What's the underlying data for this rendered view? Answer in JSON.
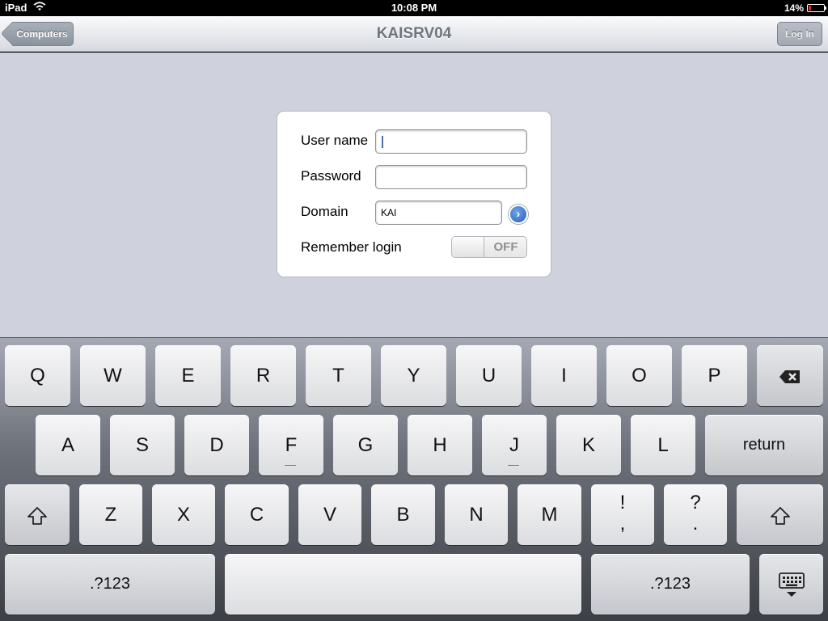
{
  "status_bar": {
    "carrier": "iPad",
    "wifi_icon": "wifi-icon",
    "time": "10:08 PM",
    "battery_percent": "14%",
    "battery_level": 0.14
  },
  "nav": {
    "back_label": "Computers",
    "title": "KAISRV04",
    "login_label": "Log In"
  },
  "form": {
    "username_label": "User name",
    "username_value": "",
    "password_label": "Password",
    "password_value": "",
    "domain_label": "Domain",
    "domain_value": "KAI",
    "remember_label": "Remember login",
    "remember_state": "OFF"
  },
  "keyboard": {
    "row1": [
      "Q",
      "W",
      "E",
      "R",
      "T",
      "Y",
      "U",
      "I",
      "O",
      "P"
    ],
    "row2": [
      "A",
      "S",
      "D",
      "F",
      "G",
      "H",
      "J",
      "K",
      "L"
    ],
    "row3": [
      "Z",
      "X",
      "C",
      "V",
      "B",
      "N",
      "M"
    ],
    "return_label": "return",
    "punct1_top": "!",
    "punct1_bottom": ",",
    "punct2_top": "?",
    "punct2_bottom": ".",
    "numbers_label": ".?123",
    "icons": {
      "backspace": "backspace-icon",
      "shift": "shift-icon",
      "dismiss": "keyboard-dismiss-icon"
    }
  },
  "colors": {
    "background": "#cfd2dc",
    "nav_text": "#6d7580",
    "accent_blue": "#2a5fb5"
  }
}
